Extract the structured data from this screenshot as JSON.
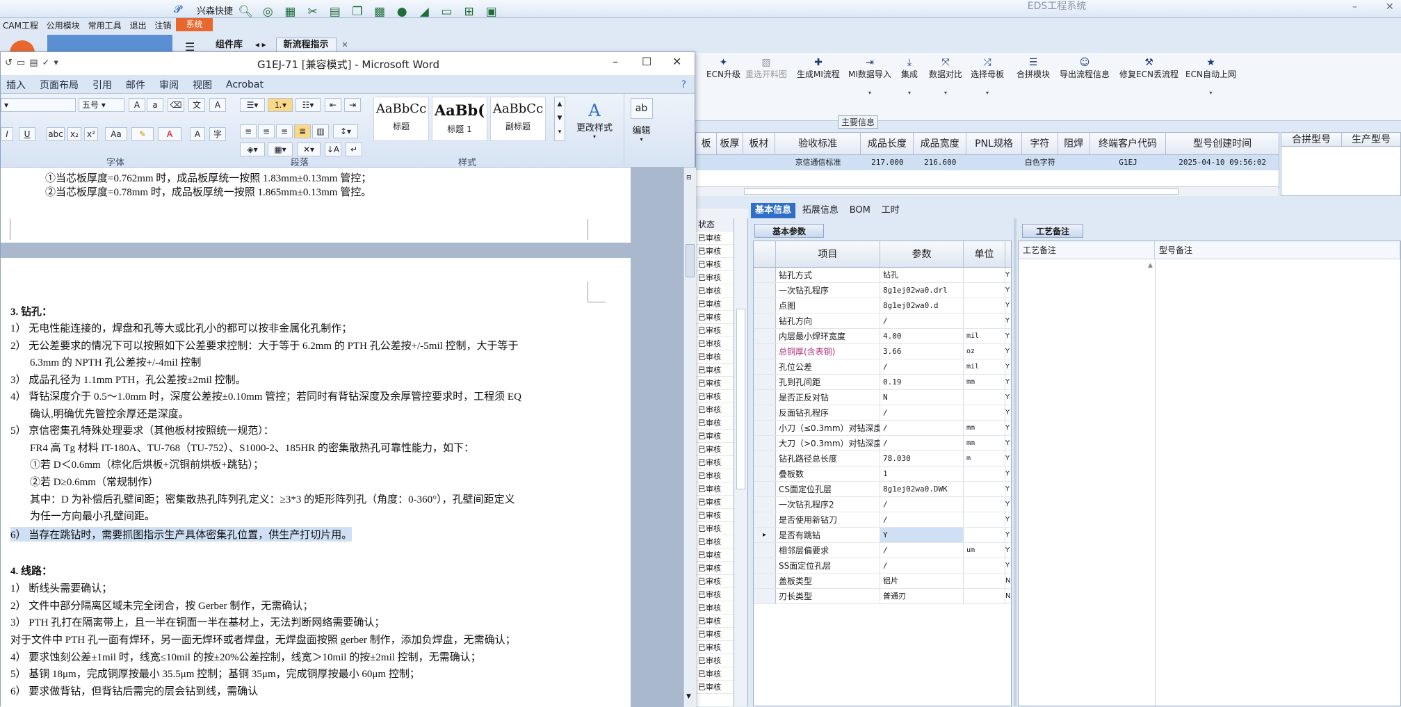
{
  "eds": {
    "title": "EDS工程系统",
    "quick_label": "兴森快捷",
    "menu": [
      "CAM工程",
      "公用模块",
      "常用工具",
      "退出",
      "注销"
    ],
    "sys_tab": "系统",
    "tabs": [
      "组件库",
      "新流程指示"
    ],
    "ribbon": [
      "ECN升级",
      "重选开料图",
      "生成MI流程",
      "MI数据导入",
      "集成",
      "数据对比",
      "选择母板",
      "合拼模块",
      "导出流程信息",
      "修复ECN丢流程",
      "ECN自动上网"
    ],
    "main_info_label": "主要信息",
    "grid_headers": [
      "板",
      "板厚",
      "板材",
      "验收标准",
      "成品长度",
      "成品宽度",
      "PNL规格",
      "字符",
      "阻焊",
      "终端客户代码",
      "型号创建时间"
    ],
    "grid_row": [
      "",
      "",
      "",
      "京信通信标准",
      "217.000",
      "216.600",
      "",
      "白色字符",
      "",
      "G1EJ",
      "2025-04-10 09:56:02"
    ],
    "merge_headers": [
      "合拼型号",
      "生产型号"
    ],
    "status_header": "状态",
    "status_value": "已审核",
    "param_tabs": [
      "基本信息",
      "拓展信息",
      "BOM",
      "工时"
    ],
    "basic_params_tab": "基本参数",
    "param_headers": [
      "项目",
      "参数",
      "单位"
    ],
    "params": [
      {
        "item": "钻孔方式",
        "value": "钻孔",
        "unit": "",
        "flag": "Y"
      },
      {
        "item": "一次钻孔程序",
        "value": "8g1ej02wa0.drl",
        "unit": "",
        "flag": "Y"
      },
      {
        "item": "点图",
        "value": "8g1ej02wa0.d",
        "unit": "",
        "flag": "Y"
      },
      {
        "item": "钻孔方向",
        "value": "/",
        "unit": "",
        "flag": "Y"
      },
      {
        "item": "内层最小焊环宽度",
        "value": "4.00",
        "unit": "mil",
        "flag": "Y"
      },
      {
        "item": "总铜厚(含表铜)",
        "value": "3.66",
        "unit": "oz",
        "flag": "Y"
      },
      {
        "item": "孔位公差",
        "value": "/",
        "unit": "mil",
        "flag": "Y"
      },
      {
        "item": "孔到孔间距",
        "value": "0.19",
        "unit": "mm",
        "flag": "Y"
      },
      {
        "item": "是否正反对钻",
        "value": "N",
        "unit": "",
        "flag": "Y"
      },
      {
        "item": "反面钻孔程序",
        "value": "/",
        "unit": "",
        "flag": "Y"
      },
      {
        "item": "小刀（≤0.3mm）对钻深度",
        "value": "/",
        "unit": "mm",
        "flag": "Y"
      },
      {
        "item": "大刀（>0.3mm）对钻深度",
        "value": "/",
        "unit": "mm",
        "flag": "Y"
      },
      {
        "item": "钻孔路径总长度",
        "value": "78.030",
        "unit": "m",
        "flag": "Y"
      },
      {
        "item": "叠板数",
        "value": "1",
        "unit": "",
        "flag": "Y"
      },
      {
        "item": "CS面定位孔层",
        "value": "8g1ej02wa0.DWK",
        "unit": "",
        "flag": "Y"
      },
      {
        "item": "一次钻孔程序2",
        "value": "/",
        "unit": "",
        "flag": "Y"
      },
      {
        "item": "是否使用新钻刀",
        "value": "/",
        "unit": "",
        "flag": "Y"
      },
      {
        "item": "是否有跳钻",
        "value": "Y",
        "unit": "",
        "flag": "Y"
      },
      {
        "item": "相邻层偏要求",
        "value": "/",
        "unit": "um",
        "flag": "Y"
      },
      {
        "item": "SS面定位孔层",
        "value": "/",
        "unit": "",
        "flag": "Y"
      },
      {
        "item": "盖板类型",
        "value": "铝片",
        "unit": "",
        "flag": "N"
      },
      {
        "item": "刃长类型",
        "value": "普通刃",
        "unit": "",
        "flag": "N"
      }
    ],
    "remark_tab": "工艺备注",
    "remark_headers": [
      "工艺备注",
      "型号备注"
    ]
  },
  "word": {
    "title": "G1EJ-71 [兼容模式] - Microsoft Word",
    "menu": [
      "插入",
      "页面布局",
      "引用",
      "邮件",
      "审阅",
      "视图",
      "Acrobat"
    ],
    "font_size": "五号",
    "groups": {
      "font": "字体",
      "paragraph": "段落",
      "styles": "样式"
    },
    "styles": [
      {
        "preview": "AaBbCc",
        "label": "标题"
      },
      {
        "preview": "AaBb(",
        "label": "标题 1"
      },
      {
        "preview": "AaBbCc",
        "label": "副标题"
      }
    ],
    "change_styles": "更改样式",
    "edit": "编辑",
    "page1_lines": [
      "①当芯板厚度=0.762mm 时，成品板厚统一按照 1.83mm±0.13mm 管控；",
      "②当芯板厚度=0.78mm 时，成品板厚统一按照 1.865mm±0.13mm 管控。"
    ],
    "page2_lines": [
      "3.   钻孔：",
      "1） 无电性能连接的，焊盘和孔等大或比孔小的都可以按非金属化孔制作；",
      "2） 无公差要求的情况下可以按照如下公差要求控制：大于等于 6.2mm 的 PTH 孔公差按+/-5mil 控制，大于等于",
      "6.3mm 的 NPTH 孔公差按+/-4mil 控制",
      "3） 成品孔径为 1.1mm PTH，孔公差按±2mil 控制。",
      "4） 背钻深度介于 0.5～1.0mm 时，深度公差按±0.10mm 管控；若同时有背钻深度及余厚管控要求时，工程须 EQ",
      "确认,明确优先管控余厚还是深度。",
      "5） 京信密集孔特殊处理要求（其他板材按照统一规范）：",
      "FR4 高 Tg 材料 IT-180A、TU-768（TU-752）、S1000-2、185HR 的密集散热孔可靠性能力，如下：",
      "①若 D＜0.6mm（棕化后烘板+沉铜前烘板+跳钻）；",
      "②若 D≥0.6mm（常规制作）",
      "其中：D 为补偿后孔壁间距；密集散热孔阵列孔定义：≥3*3 的矩形阵列孔（角度：0-360°），孔壁间距定义",
      "为任一方向最小孔壁间距。",
      "6） 当存在跳钻时，需要抓图指示生产具体密集孔位置，供生产打切片用。",
      "4.   线路：",
      "1） 断线头需要确认；",
      "2） 文件中部分隔离区域未完全闭合，按 Gerber 制作，无需确认；",
      "3） PTH 孔打在隔离带上，且一半在铜面一半在基材上，无法判断网络需要确认；",
      "对于文件中 PTH 孔一面有焊环，另一面无焊环或者焊盘，无焊盘面按照 gerber 制作，添加负焊盘，无需确认；",
      "4） 要求蚀刻公差±1mil 时，线宽≤10mil 的按±20%公差控制，线宽＞10mil 的按±2mil 控制，无需确认；",
      "5） 基铜 18μm，完成铜厚按最小 35.5μm 控制；基铜 35μm，完成铜厚按最小 60μm 控制；",
      "6） 要求做背钻，但背钻后需完的层会钻到线，需确认"
    ]
  }
}
